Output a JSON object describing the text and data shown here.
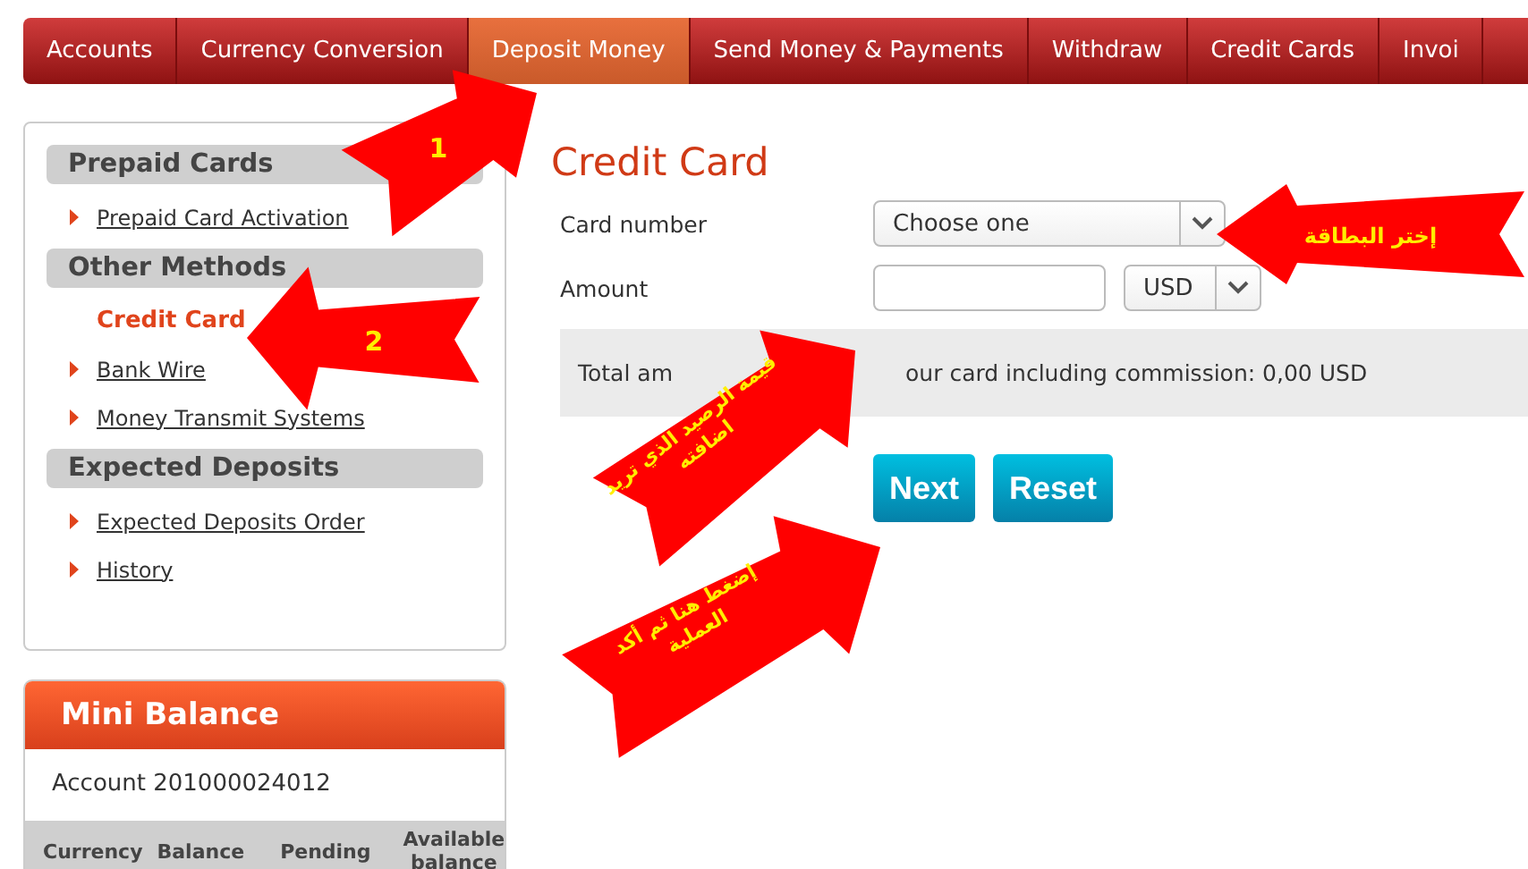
{
  "nav": {
    "tabs": [
      {
        "label": "Accounts",
        "selected": false
      },
      {
        "label": "Currency Conversion",
        "selected": false
      },
      {
        "label": "Deposit Money",
        "selected": true
      },
      {
        "label": "Send Money & Payments",
        "selected": false
      },
      {
        "label": "Withdraw",
        "selected": false
      },
      {
        "label": "Credit Cards",
        "selected": false
      },
      {
        "label": "Invoi",
        "selected": false
      }
    ]
  },
  "sidebar": {
    "groups": [
      {
        "title": "Prepaid Cards",
        "items": [
          {
            "label": "Prepaid Card Activation",
            "selected": false
          }
        ]
      },
      {
        "title": "Other Methods",
        "items": [
          {
            "label": "Credit Card",
            "selected": true
          },
          {
            "label": "Bank Wire",
            "selected": false
          },
          {
            "label": "Money Transmit Systems",
            "selected": false
          }
        ]
      },
      {
        "title": "Expected Deposits",
        "items": [
          {
            "label": "Expected Deposits Order",
            "selected": false
          },
          {
            "label": "History",
            "selected": false
          }
        ]
      }
    ]
  },
  "mini_balance": {
    "title": "Mini Balance",
    "account": "Account 201000024012",
    "columns": [
      "Currency",
      "Balance",
      "Pending",
      "Available balance"
    ]
  },
  "main": {
    "title": "Credit Card",
    "card_number": {
      "label": "Card number",
      "value": "Choose one"
    },
    "amount": {
      "label": "Amount",
      "currency": "USD"
    },
    "total": [
      "Total am",
      "our card including commission: 0,00 USD"
    ],
    "buttons": [
      "Next",
      "Reset"
    ]
  },
  "annotations": [
    {
      "lines": [
        "1"
      ]
    },
    {
      "lines": [
        "2"
      ]
    },
    {
      "lines": [
        "إختر البطاقة"
      ]
    },
    {
      "lines": [
        "قيمة الرصيد الذي تريد",
        "اضافته"
      ]
    },
    {
      "lines": [
        "إضغط هنا ثم أكد",
        "العملية"
      ]
    }
  ]
}
